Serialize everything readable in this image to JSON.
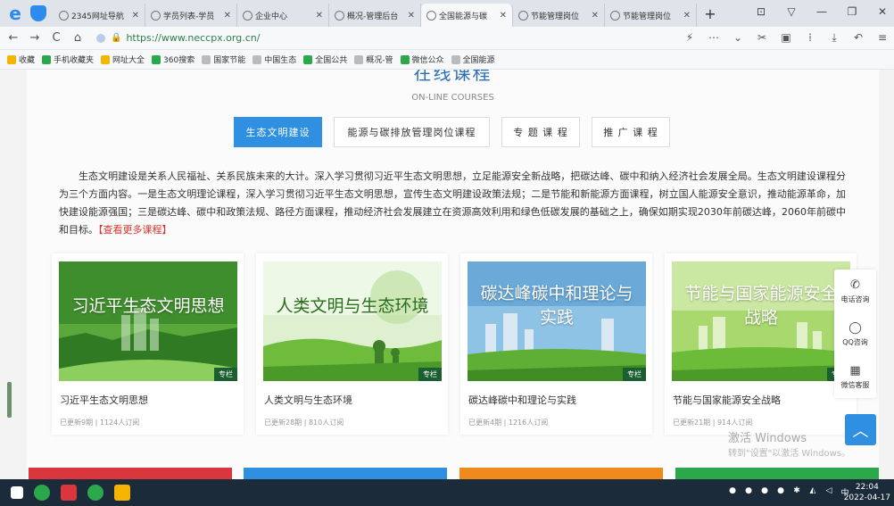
{
  "browser": {
    "tabs": [
      {
        "label": "2345网址导航",
        "active": false
      },
      {
        "label": "学员列表-学员",
        "active": false
      },
      {
        "label": "企业中心",
        "active": false
      },
      {
        "label": "概况-管理后台",
        "active": false
      },
      {
        "label": "全国能源与碳",
        "active": true
      },
      {
        "label": "节能管理岗位",
        "active": false
      },
      {
        "label": "节能管理岗位",
        "active": false
      }
    ],
    "url": "https://www.neccpx.org.cn/",
    "bookmarks": [
      "收藏",
      "手机收藏夹",
      "网址大全",
      "360搜索",
      "国家节能",
      "中国生态",
      "全国公共",
      "概况-管",
      "微信公众",
      "全国能源"
    ]
  },
  "section": {
    "title": "在线课程",
    "subtitle": "ON-LINE COURSES",
    "tabs": [
      "生态文明建设",
      "能源与碳排放管理岗位课程",
      "专 题 课 程",
      "推 广 课 程"
    ],
    "intro": "生态文明建设是关系人民福祉、关系民族未来的大计。深入学习贯彻习近平生态文明思想，立足能源安全新战略，把碳达峰、碳中和纳入经济社会发展全局。生态文明建设课程分为三个方面内容。一是生态文明理论课程，深入学习贯彻习近平生态文明思想，宣传生态文明建设政策法规；二是节能和新能源方面课程，树立国人能源安全意识，推动能源革命，加快建设能源强国；三是碳达峰、碳中和政策法规、路径方面课程，推动经济社会发展建立在资源高效利用和绿色低碳发展的基础之上，确保如期实现2030年前碳达峰，2060年前碳中和目标。",
    "more_link": "【查看更多课程】"
  },
  "courses": [
    {
      "thumb_title": "习近平生态文明思想",
      "badge": "专栏",
      "title": "习近平生态文明思想",
      "meta": "已更新9期 | 1124人订阅"
    },
    {
      "thumb_title": "人类文明与生态环境",
      "badge": "专栏",
      "title": "人类文明与生态环境",
      "meta": "已更新28期 | 810人订阅"
    },
    {
      "thumb_title": "碳达峰碳中和理论与实践",
      "badge": "专栏",
      "title": "碳达峰碳中和理论与实践",
      "meta": "已更新4期 | 1216人订阅"
    },
    {
      "thumb_title": "节能与国家能源安全战略",
      "badge": "专栏",
      "title": "节能与国家能源安全战略",
      "meta": "已更新21期 | 914人订阅"
    }
  ],
  "float_panel": [
    "电话咨询",
    "QQ咨询",
    "微信客服"
  ],
  "watermark": {
    "line1": "激活 Windows",
    "line2": "转到\"设置\"以激活 Windows。"
  },
  "taskbar": {
    "time": "22:04",
    "date": "2022-04-17",
    "ime": "中"
  },
  "colors": {
    "accent": "#2f8fe0",
    "more_link": "#d9362f",
    "strip": [
      "#d9363e",
      "#2f8fe0",
      "#f08a1c",
      "#2aa84a"
    ]
  }
}
